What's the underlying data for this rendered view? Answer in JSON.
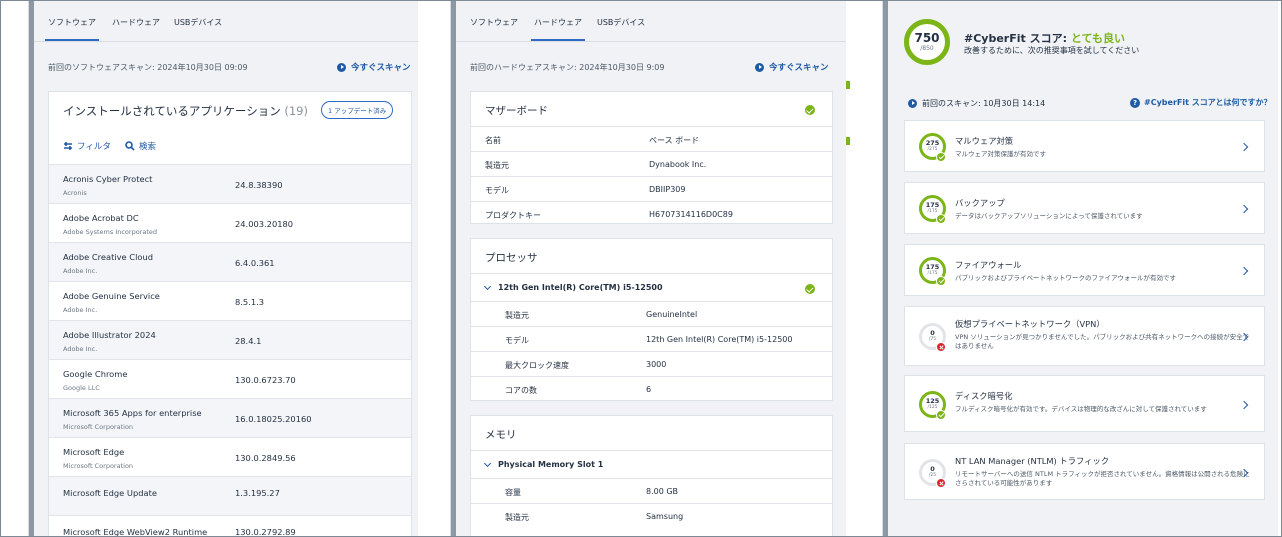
{
  "software": {
    "tabs": [
      "ソフトウェア",
      "ハードウェア",
      "USBデバイス"
    ],
    "last_scan": "前回のソフトウェアスキャン: 2024年10月30日 09:09",
    "scan_now": "今すぐスキャン",
    "apps_title": "インストールされているアプリケーション",
    "apps_count": "(19)",
    "update_badge": "1 アップデート済み",
    "filter": "フィルタ",
    "search": "検索",
    "apps": [
      {
        "name": "Acronis Cyber Protect",
        "vendor": "Acronis",
        "version": "24.8.38390"
      },
      {
        "name": "Adobe Acrobat DC",
        "vendor": "Adobe Systems Incorporated",
        "version": "24.003.20180"
      },
      {
        "name": "Adobe Creative Cloud",
        "vendor": "Adobe Inc.",
        "version": "6.4.0.361"
      },
      {
        "name": "Adobe Genuine Service",
        "vendor": "Adobe Inc.",
        "version": "8.5.1.3"
      },
      {
        "name": "Adobe Illustrator 2024",
        "vendor": "Adobe Inc.",
        "version": "28.4.1"
      },
      {
        "name": "Google Chrome",
        "vendor": "Google LLC",
        "version": "130.0.6723.70"
      },
      {
        "name": "Microsoft 365 Apps for enterprise",
        "vendor": "Microsoft Corporation",
        "version": "16.0.18025.20160"
      },
      {
        "name": "Microsoft Edge",
        "vendor": "Microsoft Corporation",
        "version": "130.0.2849.56"
      },
      {
        "name": "Microsoft Edge Update",
        "vendor": "",
        "version": "1.3.195.27"
      },
      {
        "name": "Microsoft Edge WebView2 Runtime",
        "vendor": "",
        "version": "130.0.2792.89"
      }
    ]
  },
  "hardware": {
    "tabs": [
      "ソフトウェア",
      "ハードウェア",
      "USBデバイス"
    ],
    "last_scan": "前回のハードウェアスキャン: 2024年10月30日 9:09",
    "scan_now": "今すぐスキャン",
    "motherboard": {
      "title": "マザーボード",
      "rows": [
        {
          "k": "名前",
          "v": "ベース ボード"
        },
        {
          "k": "製造元",
          "v": "Dynabook Inc."
        },
        {
          "k": "モデル",
          "v": "DBIIP309"
        },
        {
          "k": "プロダクトキー",
          "v": "H6707314116D0C89"
        }
      ]
    },
    "processor": {
      "title": "プロセッサ",
      "name": "12th Gen Intel(R) Core(TM) i5-12500",
      "rows": [
        {
          "k": "製造元",
          "v": "GenuineIntel"
        },
        {
          "k": "モデル",
          "v": "12th Gen Intel(R) Core(TM) i5-12500"
        },
        {
          "k": "最大クロック速度",
          "v": "3000"
        },
        {
          "k": "コアの数",
          "v": "6"
        }
      ]
    },
    "memory": {
      "title": "メモリ",
      "slot": "Physical Memory Slot 1",
      "rows": [
        {
          "k": "容量",
          "v": "8.00 GB"
        },
        {
          "k": "製造元",
          "v": "Samsung"
        }
      ]
    }
  },
  "cyberfit": {
    "score": "750",
    "max": "/850",
    "title_prefix": "#CyberFit スコア: ",
    "title_rating": "とても良い",
    "subtitle": "改善するために、次の推奨事項を試してください",
    "last_scan": "前回のスキャン: 10月30日 14:14",
    "help_link": "#CyberFit スコアとは何ですか？",
    "items": [
      {
        "score": "275",
        "max": "/275",
        "status": "ok",
        "title": "マルウェア対策",
        "desc": "マルウェア対策保護が有効です"
      },
      {
        "score": "175",
        "max": "/175",
        "status": "ok",
        "title": "バックアップ",
        "desc": "データはバックアップソリューションによって保護されています"
      },
      {
        "score": "175",
        "max": "/175",
        "status": "ok",
        "title": "ファイアウォール",
        "desc": "パブリックおよびプライベートネットワークのファイアウォールが有効です"
      },
      {
        "score": "0",
        "max": "/75",
        "status": "bad",
        "title": "仮想プライベートネットワーク（VPN）",
        "desc": "VPN ソリューションが見つかりませんでした。パブリックおよび共有ネットワークへの接続が安全ではありません"
      },
      {
        "score": "125",
        "max": "/125",
        "status": "ok",
        "title": "ディスク暗号化",
        "desc": "フルディスク暗号化が有効です。デバイスは物理的な改ざんに対して保護されています"
      },
      {
        "score": "0",
        "max": "/25",
        "status": "bad",
        "title": "NT LAN Manager (NTLM) トラフィック",
        "desc": "リモートサーバーへの送信 NTLM トラフィックが拒否されていません。資格情報は公開される危険にさらされている可能性があります"
      }
    ]
  },
  "sidebar_icons": [
    "pulse-icon",
    "gauge-icon",
    "shield-check-icon",
    "bolt-circle-icon",
    "patch-icon",
    "remote-desktop-icon",
    "power-icon",
    "network-icon",
    "report-icon",
    "computer-icon",
    "clock-icon",
    "alert-icon",
    "folder-add-icon",
    "close-circle-icon"
  ],
  "colors": {
    "accent": "#1f5aa6",
    "good": "#7cb518",
    "bad": "#d9262c"
  }
}
